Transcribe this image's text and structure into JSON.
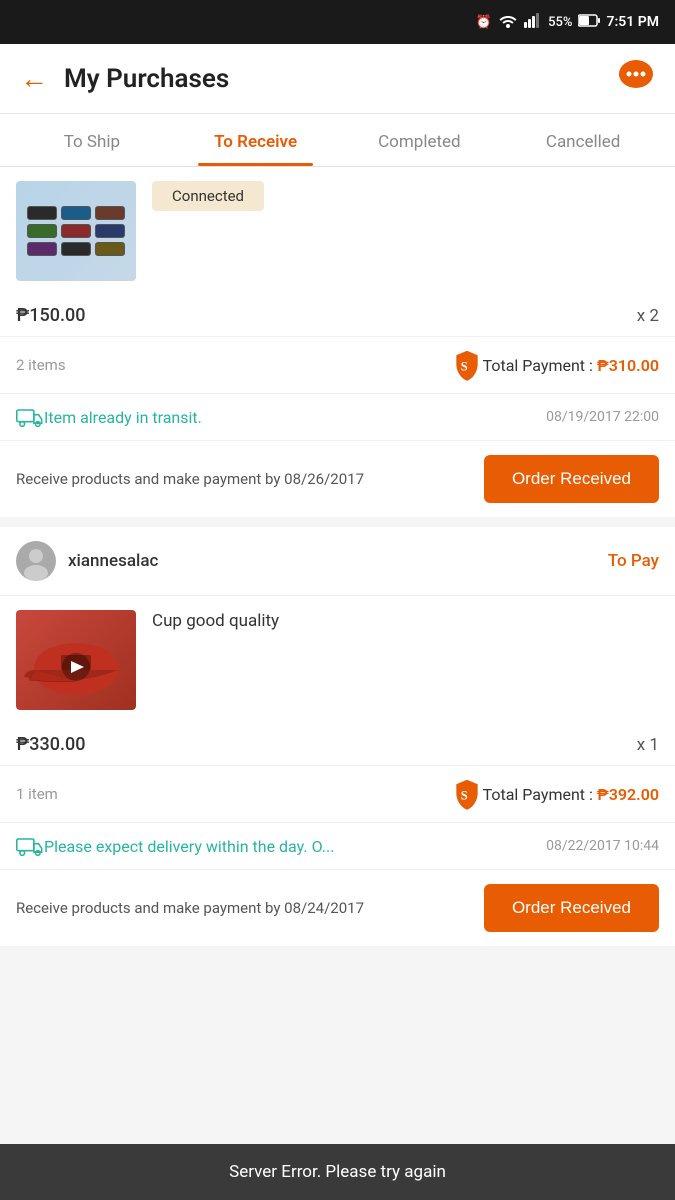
{
  "statusBar": {
    "battery": "55%",
    "time": "7:51 PM",
    "alarmIcon": "⏰",
    "wifiIcon": "wifi",
    "signalIcon": "signal"
  },
  "header": {
    "title": "My Purchases",
    "backLabel": "←",
    "chatIcon": "💬"
  },
  "tabs": [
    {
      "id": "to-ship",
      "label": "To Ship",
      "active": false
    },
    {
      "id": "to-receive",
      "label": "To Receive",
      "active": true
    },
    {
      "id": "completed",
      "label": "Completed",
      "active": false
    },
    {
      "id": "cancelled",
      "label": "Cancelled",
      "active": false
    }
  ],
  "orders": [
    {
      "id": "order-1",
      "sellerName": "",
      "orderStatus": "",
      "showConnected": true,
      "connectedLabel": "Connected",
      "price": "₱150.00",
      "qty": "x 2",
      "itemsCount": "2 items",
      "totalPaymentLabel": "Total Payment :",
      "totalAmount": "₱310.00",
      "transitText": "Item already in transit.",
      "transitDate": "08/19/2017 22:00",
      "deadlineText": "Receive products and make payment by 08/26/2017",
      "btnLabel": "Order Received"
    },
    {
      "id": "order-2",
      "sellerName": "xiannesalac",
      "orderStatus": "To Pay",
      "showConnected": false,
      "connectedLabel": "",
      "productName": "Cup good quality",
      "price": "₱330.00",
      "qty": "x 1",
      "itemsCount": "1 item",
      "totalPaymentLabel": "Total Payment :",
      "totalAmount": "₱392.00",
      "transitText": "Please expect delivery within the day. O...",
      "transitDate": "08/22/2017 10:44",
      "deadlineText": "Receive products and make payment by 08/24/2017",
      "btnLabel": "Order Received"
    }
  ],
  "errorToast": {
    "message": "Server Error. Please try again"
  }
}
